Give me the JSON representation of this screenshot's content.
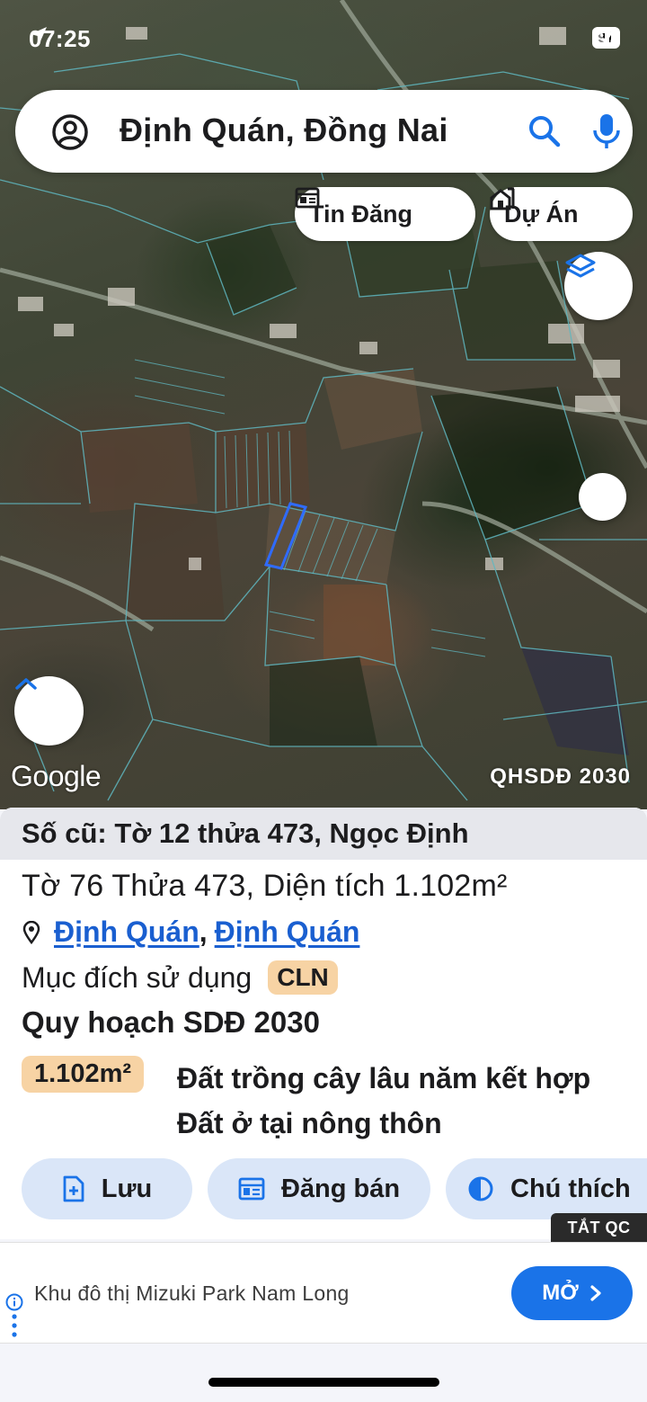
{
  "status_bar": {
    "time": "07:25",
    "battery": "97"
  },
  "search": {
    "query": "Định Quán, Đồng Nai"
  },
  "chips": {
    "news": "Tin Đăng",
    "projects": "Dự Án"
  },
  "map": {
    "attribution": "Google",
    "layer_tag": "QHSDĐ 2030"
  },
  "parcel": {
    "old_number": "Số cũ: Tờ 12 thửa 473, Ngọc Định",
    "title": "Tờ 76 Thửa 473, Diện tích 1.102m²",
    "location_district": "Định Quán",
    "location_separator": ",",
    "location_commune": "Định Quán",
    "purpose_label": "Mục đích sử dụng",
    "purpose_code": "CLN",
    "plan_title": "Quy hoạch SDĐ 2030",
    "plan_area": "1.102m²",
    "plan_description": "Đất trồng cây lâu năm kết hợp Đất ở tại nông thôn"
  },
  "actions": {
    "save": "Lưu",
    "sell": "Đăng bán",
    "legend": "Chú thích"
  },
  "ad": {
    "close_label": "TẮT QC",
    "text": "Khu đô thị Mizuki Park Nam Long",
    "open_label": "MỞ"
  },
  "colors": {
    "accent": "#1a73e8",
    "link": "#1a5fd0",
    "badge": "#f7d3a4",
    "action_bg": "#dae6f8",
    "parcel_outline": "#2f6bff"
  }
}
